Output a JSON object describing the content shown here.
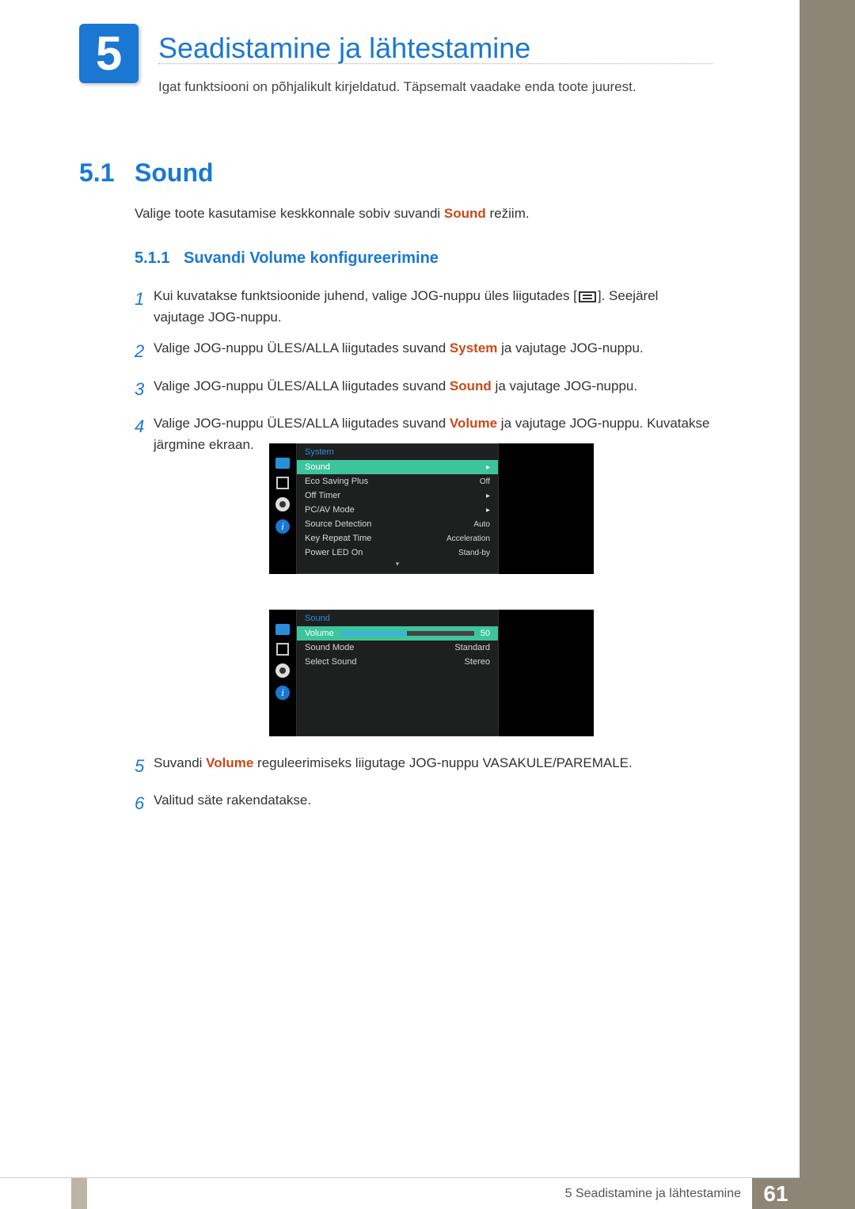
{
  "chapter": {
    "number": "5",
    "title": "Seadistamine ja lähtestamine",
    "description": "Igat funktsiooni on põhjalikult kirjeldatud. Täpsemalt vaadake enda toote juurest."
  },
  "section": {
    "number": "5.1",
    "title": "Sound",
    "intro_pre": "Valige toote kasutamise keskkonnale sobiv suvandi ",
    "intro_kw": "Sound",
    "intro_post": " režiim.",
    "sub_number": "5.1.1",
    "sub_title": "Suvandi Volume konfigureerimine"
  },
  "steps": {
    "s1_num": "1",
    "s1a": "Kui kuvatakse funktsioonide juhend, valige JOG-nuppu üles liigutades [",
    "s1b": "]. Seejärel vajutage JOG-nuppu.",
    "s2_num": "2",
    "s2a": "Valige JOG-nuppu ÜLES/ALLA liigutades suvand ",
    "s2_kw": "System",
    "s2b": " ja vajutage JOG-nuppu.",
    "s3_num": "3",
    "s3a": "Valige JOG-nuppu ÜLES/ALLA liigutades suvand ",
    "s3_kw": "Sound",
    "s3b": " ja vajutage JOG-nuppu.",
    "s4_num": "4",
    "s4a": "Valige JOG-nuppu ÜLES/ALLA liigutades suvand ",
    "s4_kw": "Volume",
    "s4b": " ja vajutage JOG-nuppu. Kuvatakse järgmine ekraan.",
    "s5_num": "5",
    "s5a": "Suvandi ",
    "s5_kw": "Volume",
    "s5b": " reguleerimiseks liigutage JOG-nuppu VASAKULE/PAREMALE.",
    "s6_num": "6",
    "s6a": "Valitud säte rakendatakse."
  },
  "osd1": {
    "header": "System",
    "rows": [
      {
        "label": "Sound",
        "value": "▸",
        "hl": true
      },
      {
        "label": "Eco Saving Plus",
        "value": "Off"
      },
      {
        "label": "Off Timer",
        "value": "▸"
      },
      {
        "label": "PC/AV Mode",
        "value": "▸"
      },
      {
        "label": "Source Detection",
        "value": "Auto"
      },
      {
        "label": "Key Repeat Time",
        "value": "Acceleration"
      },
      {
        "label": "Power LED On",
        "value": "Stand-by"
      }
    ],
    "scroll": "▾"
  },
  "osd2": {
    "header": "Sound",
    "vol_label": "Volume",
    "vol_value": "50",
    "rows": [
      {
        "label": "Sound Mode",
        "value": "Standard"
      },
      {
        "label": "Select Sound",
        "value": "Stereo"
      }
    ]
  },
  "icon_info_char": "i",
  "footer": {
    "text": "5 Seadistamine ja lähtestamine",
    "page": "61"
  }
}
